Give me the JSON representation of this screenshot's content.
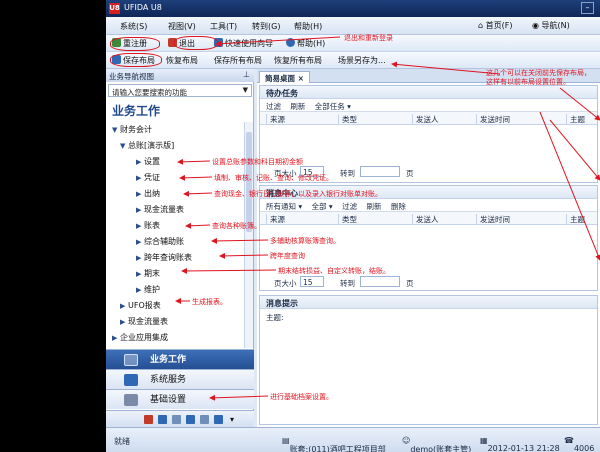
{
  "window": {
    "title": "UFIDA U8",
    "logo_text": "U8"
  },
  "menu": {
    "items": [
      "系统(S)",
      "视图(V)",
      "工具(T)",
      "转到(G)",
      "帮助(H)"
    ],
    "home": "首页(F)",
    "nav": "导航(N)"
  },
  "toolbar1": {
    "items": [
      "重注册",
      "退出",
      "快速使用向导",
      "帮助(H)"
    ]
  },
  "toolbar2": {
    "items": [
      "保存布局",
      "恢复布局",
      "保存所有布局",
      "恢复所有布局",
      "场景另存为..."
    ]
  },
  "sidebar": {
    "header": "业务导航视图",
    "search_placeholder": "请输入您要搜索的功能",
    "title": "业务工作",
    "tree": [
      {
        "label": "财务会计",
        "level": 0,
        "arrow": "▼"
      },
      {
        "label": "总账[演示版]",
        "level": 1,
        "arrow": "▼"
      },
      {
        "label": "设置",
        "level": 2,
        "arrow": "▶"
      },
      {
        "label": "凭证",
        "level": 2,
        "arrow": "▶"
      },
      {
        "label": "出纳",
        "level": 2,
        "arrow": "▶"
      },
      {
        "label": "现金流量表",
        "level": 2,
        "arrow": "▶"
      },
      {
        "label": "账表",
        "level": 2,
        "arrow": "▶"
      },
      {
        "label": "综合辅助账",
        "level": 2,
        "arrow": "▶"
      },
      {
        "label": "跨年查询账表",
        "level": 2,
        "arrow": "▶"
      },
      {
        "label": "期末",
        "level": 2,
        "arrow": "▶"
      },
      {
        "label": "维护",
        "level": 2,
        "arrow": "▶"
      },
      {
        "label": "UFO报表",
        "level": 1,
        "arrow": "▶"
      },
      {
        "label": "现金流量表",
        "level": 1,
        "arrow": "▶"
      },
      {
        "label": "企业应用集成",
        "level": 0,
        "arrow": "▶"
      }
    ],
    "nav_buttons": [
      "业务工作",
      "系统服务",
      "基础设置"
    ]
  },
  "content": {
    "tab_label": "简易桌面",
    "tab_close": "×",
    "todo": {
      "title": "待办任务",
      "tools": [
        "过滤",
        "刷新",
        "全部任务 ▾"
      ],
      "columns": [
        "来源",
        "类型",
        "发送人",
        "发送时间",
        "主题"
      ],
      "page_size_label": "页大小",
      "page_size": "15",
      "goto_label": "转到",
      "page_unit": "页"
    },
    "notice": {
      "title": "消息中心",
      "tools": [
        "所有通知 ▾",
        "全部 ▾",
        "过滤",
        "刷新",
        "删除"
      ],
      "columns": [
        "来源",
        "类型",
        "发送人",
        "发送时间",
        "主题"
      ],
      "page_size_label": "页大小",
      "page_size": "15",
      "goto_label": "转到",
      "page_unit": "页"
    },
    "reminder": {
      "title": "消息提示",
      "subject_label": "主题:"
    }
  },
  "statusbar": {
    "left": "就绪",
    "account": "账套:(011)酒吧工程项目部",
    "user": "demo(账套主管)",
    "datetime": "2012-01-13 21:28",
    "phone": "4006"
  },
  "annotations": {
    "logout": "退出和重新登录",
    "layout": "这几个可以在关闭前先保存布局，",
    "layout2": "这样有以前布局设置位置。",
    "settings": "设置总账参数和科目期初金额",
    "voucher": "填制、审核、记账、查询、修改凭证。",
    "cashier": "查询现金、银行日记账等，以及录入银行对账单对账。",
    "reports": "查询各种账簿。",
    "aux": "多辅助核算账簿查询。",
    "crossyear": "跨年度查询",
    "period_end": "期末结转损益、自定义转账，结账。",
    "ufo": "生成报表。",
    "basic": "进行基础档案设置。"
  },
  "colors": {
    "title_bar": "#1d3f7a",
    "annotation": "#e0141e",
    "active_nav": "#2f5ea6"
  }
}
